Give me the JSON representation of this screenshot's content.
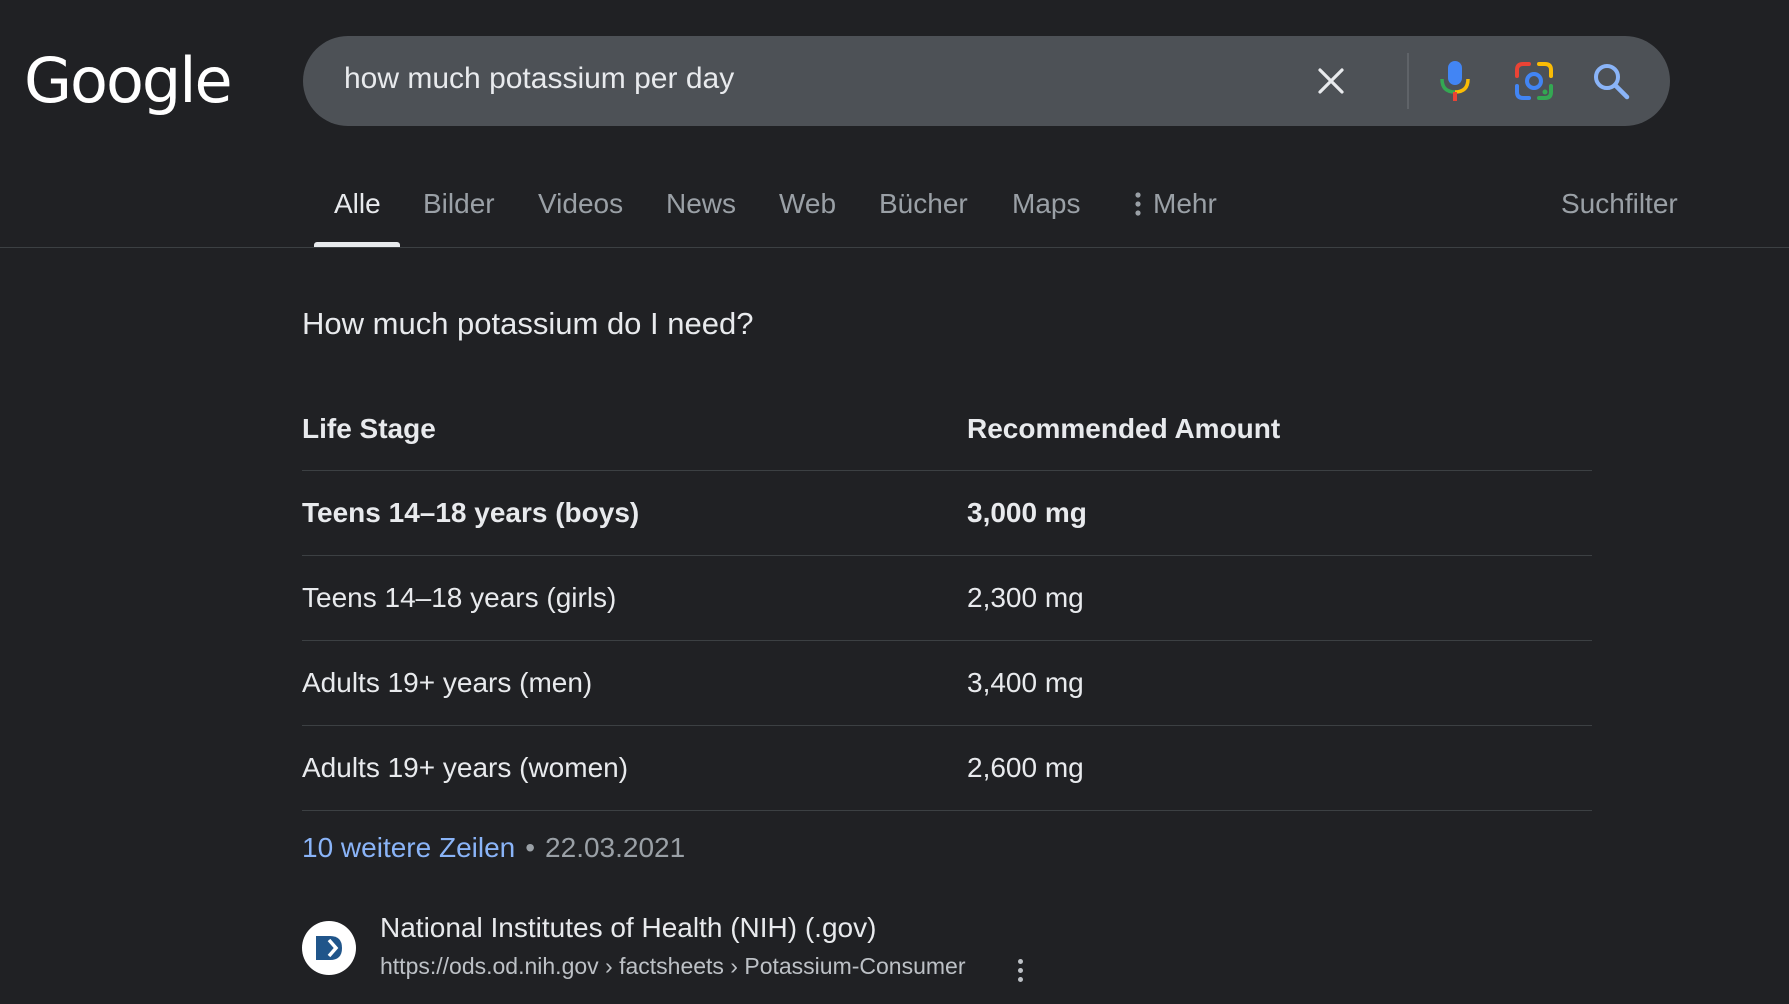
{
  "logo": {
    "text": "Google"
  },
  "search": {
    "query": "how much potassium per day",
    "icons": [
      "close-icon",
      "microphone-icon",
      "google-lens-icon",
      "search-icon"
    ]
  },
  "tabs": [
    {
      "label": "Alle",
      "active": true
    },
    {
      "label": "Bilder"
    },
    {
      "label": "Videos"
    },
    {
      "label": "News"
    },
    {
      "label": "Web"
    },
    {
      "label": "Bücher"
    },
    {
      "label": "Maps"
    },
    {
      "label": "Mehr",
      "icon": "more-vertical-icon"
    }
  ],
  "search_tools": {
    "label": "Suchfilter"
  },
  "snippet": {
    "question": "How much potassium do I need?",
    "table": {
      "headers": [
        "Life Stage",
        "Recommended Amount"
      ],
      "rows": [
        [
          "Teens 14–18 years (boys)",
          "3,000 mg"
        ],
        [
          "Teens 14–18 years (girls)",
          "2,300 mg"
        ],
        [
          "Adults 19+ years (men)",
          "3,400 mg"
        ],
        [
          "Adults 19+ years (women)",
          "2,600 mg"
        ]
      ]
    },
    "more_rows_link": "10 weitere Zeilen",
    "separator": "•",
    "date": "22.03.2021"
  },
  "source": {
    "name": "National Institutes of Health (NIH) (.gov)",
    "url": "https://ods.od.nih.gov › factsheets › Potassium-Consumer",
    "favicon": "nih-logo-icon"
  },
  "colors": {
    "background": "#202124",
    "searchbox": "#4d5156",
    "link": "#8ab4f8",
    "text": "#e8eaed",
    "muted": "#9aa0a6"
  }
}
